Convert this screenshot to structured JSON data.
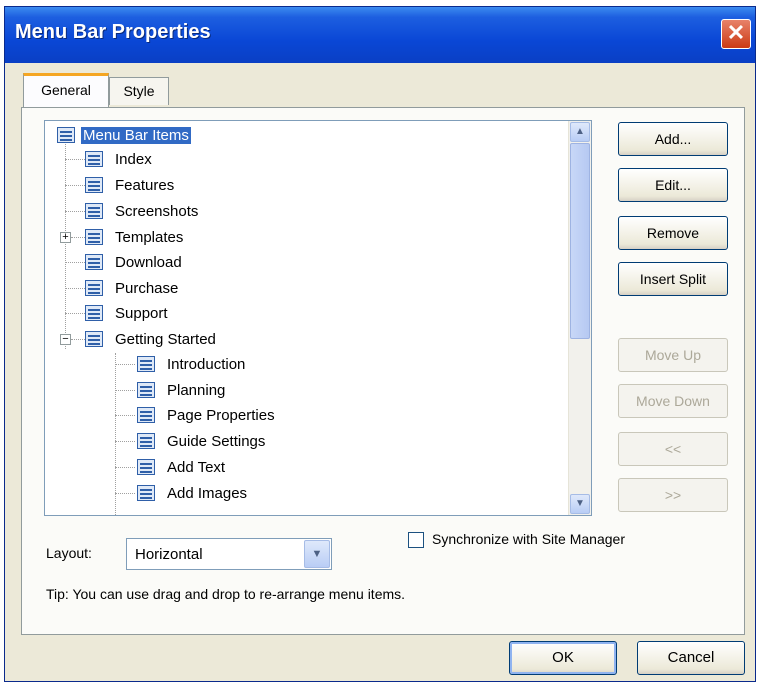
{
  "window": {
    "title": "Menu Bar Properties",
    "close_glyph": "✕"
  },
  "tabs": [
    {
      "label": "General",
      "active": true
    },
    {
      "label": "Style",
      "active": false
    }
  ],
  "tree": {
    "root": {
      "label": "Menu Bar Items",
      "icon": "menu-item-icon"
    },
    "items": [
      {
        "label": "Index",
        "icon": "menu-item-icon"
      },
      {
        "label": "Features",
        "icon": "menu-item-icon"
      },
      {
        "label": "Screenshots",
        "icon": "menu-item-icon"
      },
      {
        "label": "Templates",
        "icon": "menu-item-icon",
        "expander": "+"
      },
      {
        "label": "Download",
        "icon": "menu-item-icon"
      },
      {
        "label": "Purchase",
        "icon": "menu-item-icon"
      },
      {
        "label": "Support",
        "icon": "menu-item-icon"
      },
      {
        "label": "Getting Started",
        "icon": "menu-item-icon",
        "expander": "−"
      }
    ],
    "children": [
      {
        "label": "Introduction",
        "icon": "menu-item-icon"
      },
      {
        "label": "Planning",
        "icon": "menu-item-icon"
      },
      {
        "label": "Page Properties",
        "icon": "menu-item-icon"
      },
      {
        "label": "Guide Settings",
        "icon": "menu-item-icon"
      },
      {
        "label": "Add Text",
        "icon": "menu-item-icon"
      },
      {
        "label": "Add Images",
        "icon": "menu-item-icon"
      }
    ],
    "scroll_up": "▲",
    "scroll_down": "▼"
  },
  "buttons": {
    "add": "Add...",
    "edit": "Edit...",
    "remove": "Remove",
    "insert_split": "Insert Split",
    "move_up": "Move Up",
    "move_down": "Move Down",
    "left": "<<",
    "right": ">>"
  },
  "layout": {
    "label": "Layout:",
    "value": "Horizontal",
    "arrow": "▼"
  },
  "sync": {
    "label": "Synchronize with Site Manager",
    "checked": false
  },
  "tip": "Tip: You can use drag and drop to re-arrange menu items.",
  "footer": {
    "ok": "OK",
    "cancel": "Cancel"
  },
  "colors": {
    "title_bar": "#0a47d6",
    "selection": "#316ac5",
    "face": "#ece9d8",
    "tab_accent": "#f5a623"
  }
}
